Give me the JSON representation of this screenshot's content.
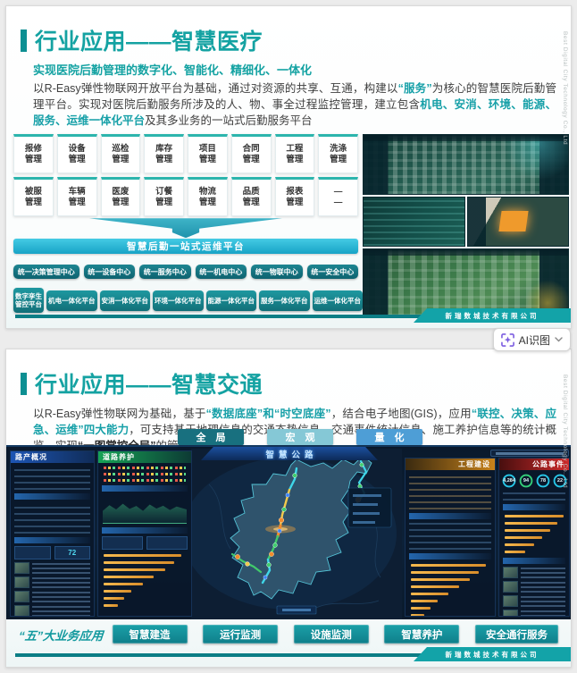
{
  "page": {
    "ai_button": {
      "label": "AI识图"
    }
  },
  "slide_medical": {
    "title": "行业应用——智慧医疗",
    "subtitle": "实现医院后勤管理的数字化、智能化、精细化、一体化",
    "body": [
      {
        "t": "以R-Easy弹性物联网开放平台为基础，通过对资源的共享、互通，构建以",
        "s": "n"
      },
      {
        "t": "“服务”",
        "s": "hl"
      },
      {
        "t": "为核心的智慧医院后勤管理平台。实现对医院后勤服务所涉及的人、物、事全过程监控管理，建立包含",
        "s": "n"
      },
      {
        "t": "机电、安消、环境、能源、服务、运维一体化平台",
        "s": "hl"
      },
      {
        "t": "及其多业务的一站式后勤服务平台",
        "s": "n"
      }
    ],
    "modules_row1": [
      {
        "top": "报修",
        "bot": "管理"
      },
      {
        "top": "设备",
        "bot": "管理"
      },
      {
        "top": "巡检",
        "bot": "管理"
      },
      {
        "top": "库存",
        "bot": "管理"
      },
      {
        "top": "项目",
        "bot": "管理"
      },
      {
        "top": "合同",
        "bot": "管理"
      },
      {
        "top": "工程",
        "bot": "管理"
      },
      {
        "top": "洗涤",
        "bot": "管理"
      }
    ],
    "modules_row2": [
      {
        "top": "被服",
        "bot": "管理"
      },
      {
        "top": "车辆",
        "bot": "管理"
      },
      {
        "top": "医废",
        "bot": "管理"
      },
      {
        "top": "订餐",
        "bot": "管理"
      },
      {
        "top": "物流",
        "bot": "管理"
      },
      {
        "top": "品质",
        "bot": "管理"
      },
      {
        "top": "报表",
        "bot": "管理"
      },
      {
        "top": "—",
        "bot": "—"
      }
    ],
    "banner": "智慧后勤一站式运维平台",
    "centers": [
      "统一决策管理中心",
      "统一设备中心",
      "统一服务中心",
      "统一机电中心",
      "统一物联中心",
      "统一安全中心"
    ],
    "platform_first": {
      "line1": "数字孪生",
      "line2": "管控平台"
    },
    "platforms": [
      "机电一体化平台",
      "安消一体化平台",
      "环境一体化平台",
      "能源一体化平台",
      "服务一体化平台",
      "运维一体化平台"
    ],
    "footer_company": "新瑞数城技术有限公司",
    "side_text": "Best Digital City Technology Co., Ltd"
  },
  "slide_traffic": {
    "title": "行业应用——智慧交通",
    "body": [
      {
        "t": "以R-Easy弹性物联网为基础，基于",
        "s": "n"
      },
      {
        "t": "“数据底座”和“时空底座”",
        "s": "hl"
      },
      {
        "t": "，结合电子地图(GIS)，应用",
        "s": "n"
      },
      {
        "t": "“联控、决策、应急、运维”四大能力",
        "s": "hl"
      },
      {
        "t": "，可支持基于地理信息的交通态势信息、交通事件统计信息、施工养护信息等的统计概览，实现",
        "s": "n"
      },
      {
        "t": "“一图掌控全局”",
        "s": "b"
      },
      {
        "t": "的管理要求.",
        "s": "n"
      }
    ],
    "view_buttons": [
      {
        "label": "全 局",
        "bg": "#18707f"
      },
      {
        "label": "宏 观",
        "bg": "#85c8d6"
      },
      {
        "label": "量 化",
        "bg": "#4e9ed6"
      }
    ],
    "dashboard": {
      "title": "智慧公路",
      "panel_road_assets": "路产概况",
      "panel_maintenance": "道路养护",
      "panel_construction": "工程建设",
      "panel_events": "公路事件",
      "stat_value": "72",
      "gauges": [
        {
          "v": "4,284",
          "ring": "#27c7e8"
        },
        {
          "v": "94",
          "ring": "#34d07a"
        },
        {
          "v": "78",
          "ring": "#27c7e8"
        },
        {
          "v": "22",
          "ring": "#27c7e8"
        }
      ]
    },
    "biz_label": "“五”大业务应用",
    "biz_buttons": [
      "智慧建造",
      "运行监测",
      "设施监测",
      "智慧养护",
      "安全通行服务"
    ],
    "footer_company": "新瑞数城技术有限公司",
    "side_text": "Best Digital City Technology Co., Ltd"
  }
}
